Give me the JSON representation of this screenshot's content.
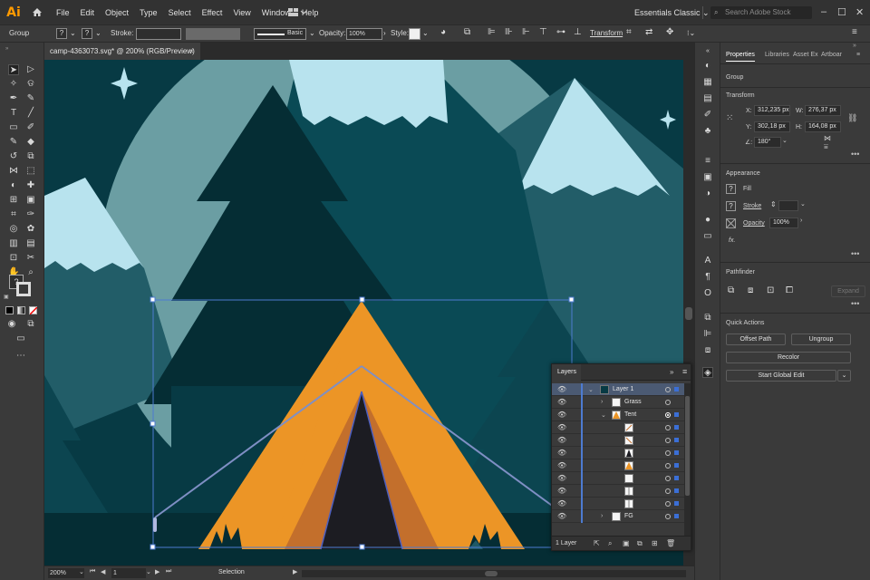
{
  "app": {
    "logo": "Ai",
    "workspace": "Essentials Classic",
    "stock_placeholder": "Search Adobe Stock"
  },
  "menu": [
    "File",
    "Edit",
    "Object",
    "Type",
    "Select",
    "Effect",
    "View",
    "Window",
    "Help"
  ],
  "control_bar": {
    "selection_label": "Group",
    "stroke_label": "Stroke:",
    "brush_label": "Basic",
    "opacity_label": "Opacity:",
    "opacity_value": "100%",
    "style_label": "Style:",
    "transform_label": "Transform"
  },
  "document": {
    "tab_title": "camp-4363073.svg* @ 200% (RGB/Preview)",
    "close_glyph": "×"
  },
  "status": {
    "zoom": "200%",
    "artboard": "1",
    "mode": "Selection"
  },
  "properties": {
    "tabs": [
      "Properties",
      "Libraries",
      "Asset Ex",
      "Artboar"
    ],
    "section_kind": "Group",
    "transform_title": "Transform",
    "x_label": "X:",
    "x_value": "312,235 px",
    "w_label": "W:",
    "w_value": "276,37 px",
    "y_label": "Y:",
    "y_value": "302,18 px",
    "h_label": "H:",
    "h_value": "164,08 px",
    "angle_label": "∠:",
    "angle_value": "180°",
    "appearance_title": "Appearance",
    "fill_label": "Fill",
    "stroke_label": "Stroke",
    "opacity_label": "Opacity",
    "opacity_value": "100%",
    "fx_label": "fx.",
    "pathfinder_title": "Pathfinder",
    "expand_label": "Expand",
    "quick_actions_title": "Quick Actions",
    "offset_path": "Offset Path",
    "ungroup": "Ungroup",
    "recolor": "Recolor",
    "global_edit": "Start Global Edit"
  },
  "layers": {
    "title": "Layers",
    "footer": "1 Layer",
    "rows": [
      {
        "name": "Layer 1"
      },
      {
        "name": "Grass"
      },
      {
        "name": "Tent"
      },
      {
        "name": ""
      },
      {
        "name": ""
      },
      {
        "name": ""
      },
      {
        "name": ""
      },
      {
        "name": ""
      },
      {
        "name": ""
      },
      {
        "name": ""
      },
      {
        "name": "FG"
      }
    ]
  },
  "colors": {
    "accent": "#ff9a00",
    "canvas_bg": "#073a44",
    "tent": "#ec9526",
    "selection": "#4d7bd1"
  }
}
